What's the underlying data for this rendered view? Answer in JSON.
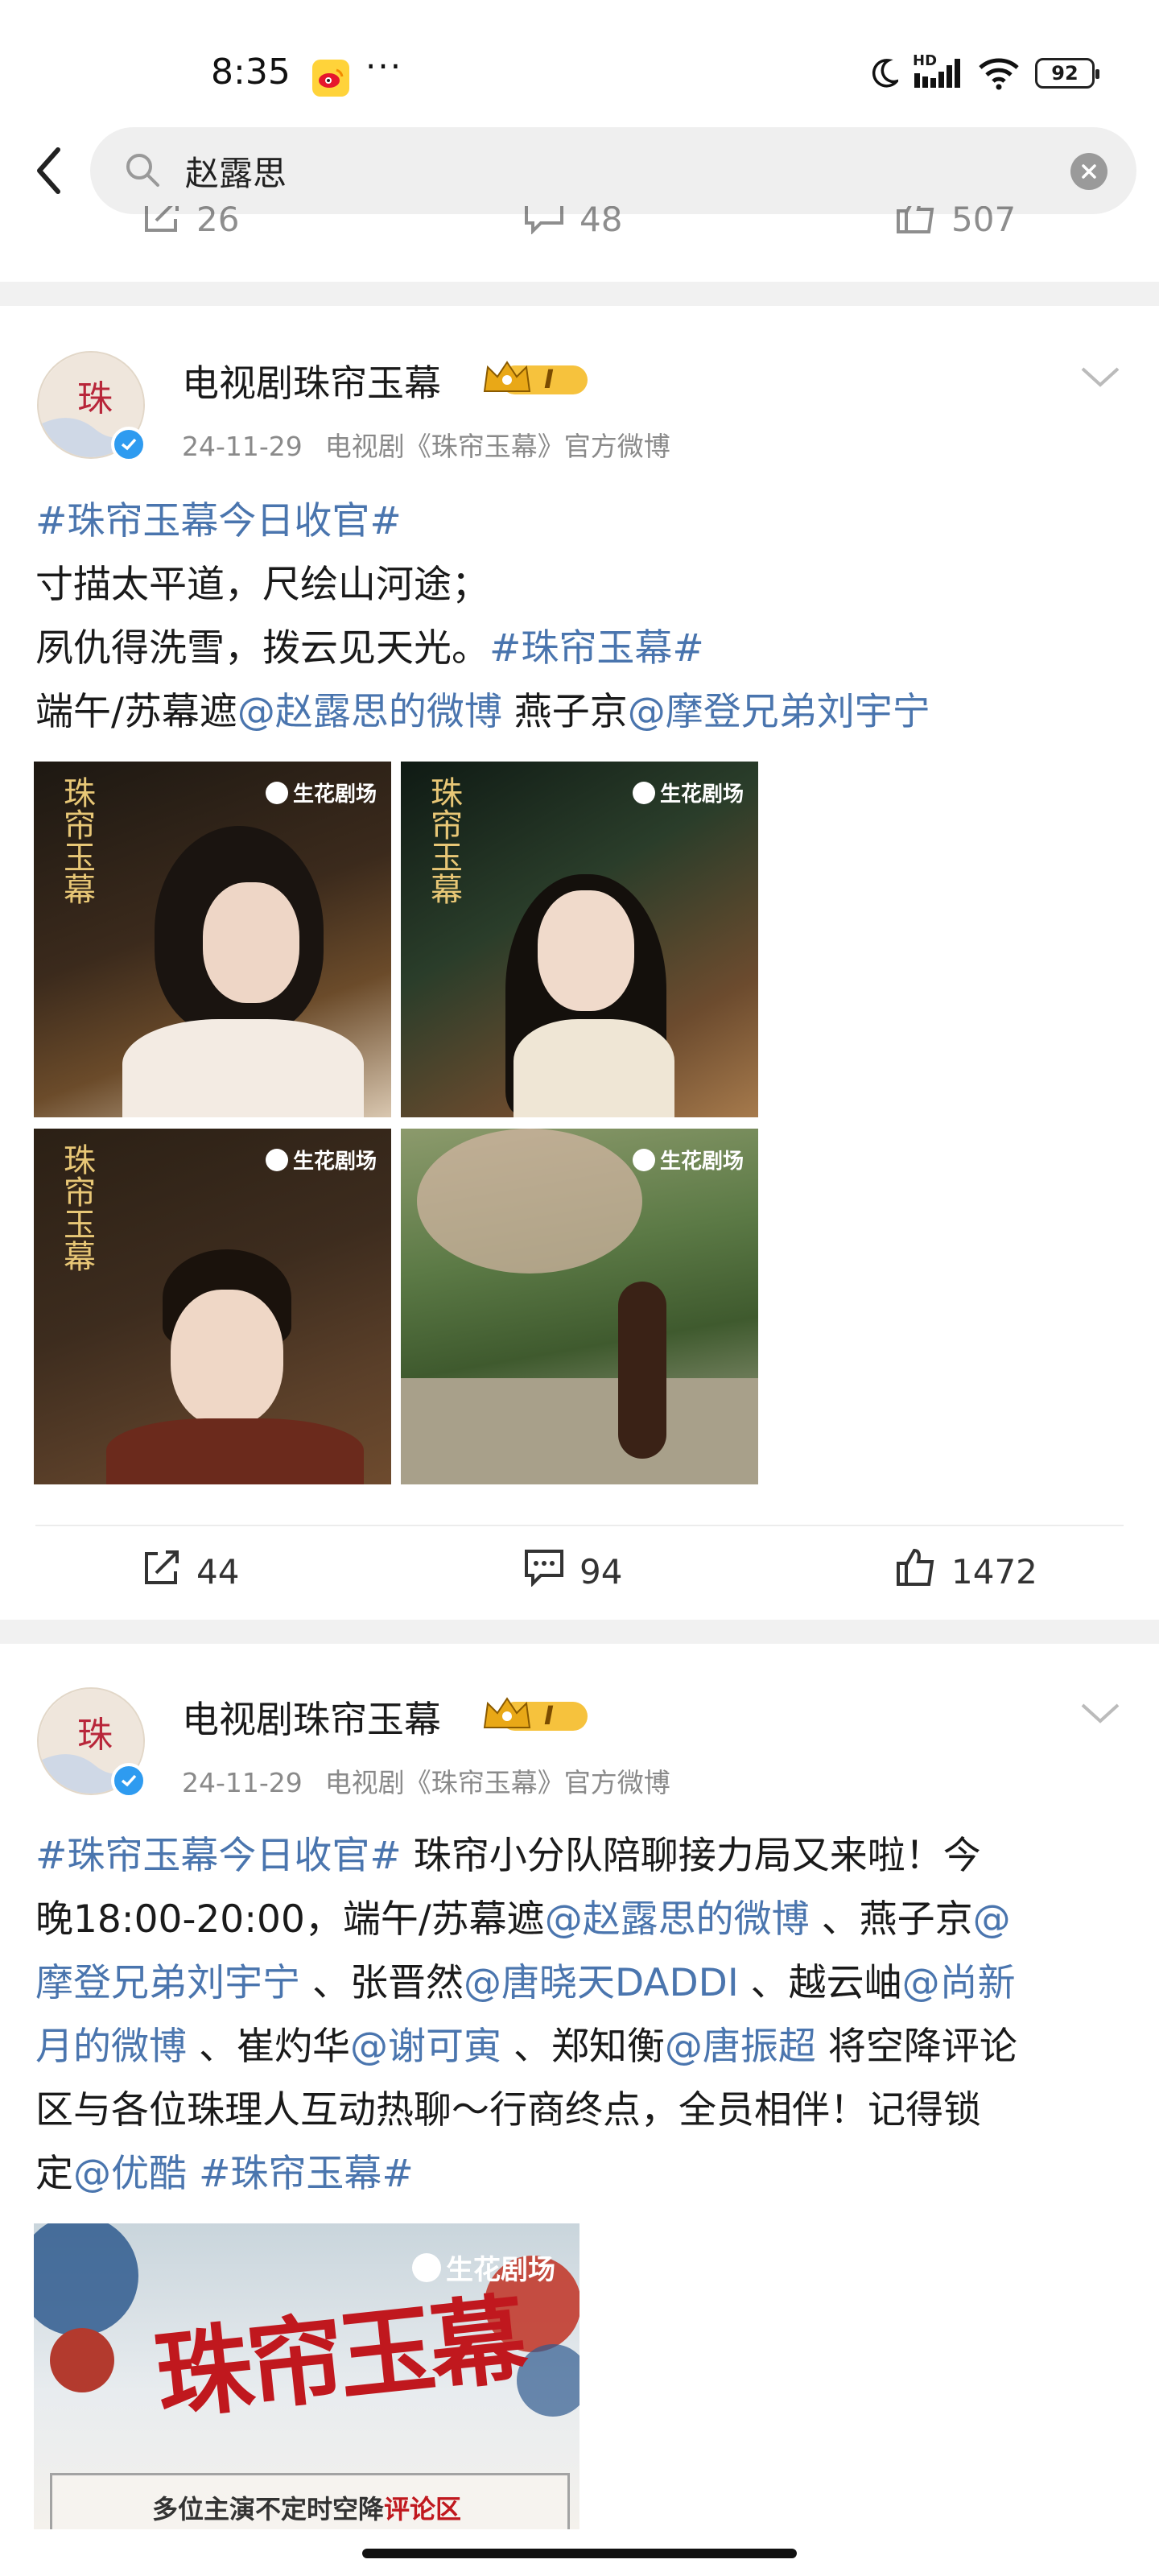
{
  "status_bar": {
    "time": "8:35",
    "dots": "···",
    "network": "HD",
    "battery": "92"
  },
  "search": {
    "query": "赵露思"
  },
  "prev_actions": {
    "shares": "26",
    "comments": "48",
    "likes": "507"
  },
  "posts": [
    {
      "author": "电视剧珠帘玉幕",
      "level": "I",
      "date": "24-11-29",
      "source": "电视剧《珠帘玉幕》官方微博",
      "lines": [
        [
          {
            "t": "#珠帘玉幕今日收官#",
            "link": true
          }
        ],
        [
          {
            "t": "寸描太平道，尺绘山河途；",
            "link": false
          }
        ],
        [
          {
            "t": "夙仇得洗雪，拨云见天光。",
            "link": false
          },
          {
            "t": "#珠帘玉幕#",
            "link": true
          }
        ],
        [
          {
            "t": "端午/苏幕遮",
            "link": false
          },
          {
            "t": "@赵露思的微博",
            "link": true
          },
          {
            "t": " 燕子京",
            "link": false
          },
          {
            "t": "@摩登兄弟刘宇宁",
            "link": true
          }
        ]
      ],
      "image_brand": "生花剧场",
      "image_logo": "珠帘玉幕",
      "shares": "44",
      "comments": "94",
      "likes": "1472"
    },
    {
      "author": "电视剧珠帘玉幕",
      "level": "I",
      "date": "24-11-29",
      "source": "电视剧《珠帘玉幕》官方微博",
      "lines": [
        [
          {
            "t": "#珠帘玉幕今日收官#",
            "link": true
          },
          {
            "t": " 珠帘小分队陪聊接力局又来啦！今",
            "link": false
          }
        ],
        [
          {
            "t": "晚18:00-20:00，端午/苏幕遮",
            "link": false
          },
          {
            "t": "@赵露思的微博",
            "link": true
          },
          {
            "t": " 、燕子京",
            "link": false
          },
          {
            "t": "@",
            "link": true
          }
        ],
        [
          {
            "t": "摩登兄弟刘宇宁",
            "link": true
          },
          {
            "t": " 、张晋然",
            "link": false
          },
          {
            "t": "@唐晓天DADDI",
            "link": true
          },
          {
            "t": " 、越云岫",
            "link": false
          },
          {
            "t": "@尚新",
            "link": true
          }
        ],
        [
          {
            "t": "月的微博",
            "link": true
          },
          {
            "t": " 、崔灼华",
            "link": false
          },
          {
            "t": "@谢可寅",
            "link": true
          },
          {
            "t": " 、郑知衡",
            "link": false
          },
          {
            "t": "@唐振超",
            "link": true
          },
          {
            "t": " 将空降评论",
            "link": false
          }
        ],
        [
          {
            "t": "区与各位珠理人互动热聊～行商终点，全员相伴！记得锁",
            "link": false
          }
        ],
        [
          {
            "t": "定",
            "link": false
          },
          {
            "t": "@优酷",
            "link": true
          },
          {
            "t": " ",
            "link": false
          },
          {
            "t": "#珠帘玉幕#",
            "link": true
          }
        ]
      ],
      "poster": {
        "brand": "生花剧场",
        "title": "珠帘玉幕",
        "caption": "多位主演不定时空降",
        "caption_em": "评论区"
      }
    }
  ]
}
